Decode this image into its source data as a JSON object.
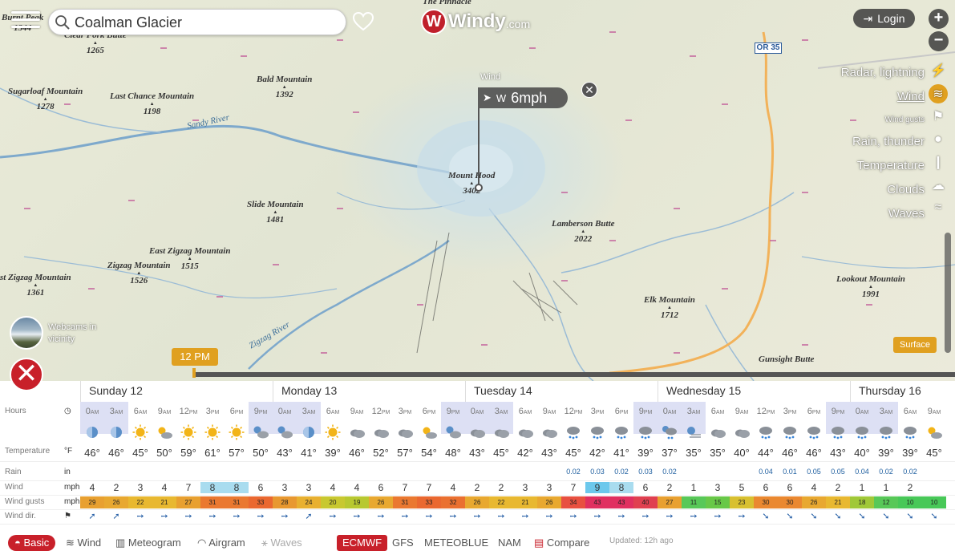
{
  "search": {
    "value": "Coalman Glacier"
  },
  "logo": {
    "mark": "W",
    "text": "Windy",
    "suffix": ".com"
  },
  "login_label": "Login",
  "zoom": {
    "in": "+",
    "out": "−"
  },
  "layers": [
    "Radar, lightning",
    "Wind",
    "Wind gusts",
    "Rain, thunder",
    "Temperature",
    "Clouds",
    "Waves"
  ],
  "active_layer": "Wind",
  "peaks": [
    {
      "name": "The Pinnacle",
      "elev": ""
    },
    {
      "name": "Burnt Peak",
      "elev": "1344"
    },
    {
      "name": "Clear Fork Butte",
      "elev": "1265"
    },
    {
      "name": "Sugarloaf Mountain",
      "elev": "1278"
    },
    {
      "name": "Bald Mountain",
      "elev": "1392"
    },
    {
      "name": "Last Chance Mountain",
      "elev": "1198"
    },
    {
      "name": "Mount Hood",
      "elev": "3402"
    },
    {
      "name": "Lamberson Butte",
      "elev": "2022"
    },
    {
      "name": "Slide Mountain",
      "elev": "1481"
    },
    {
      "name": "East Zigzag Mountain",
      "elev": "1515"
    },
    {
      "name": "Zigzag Mountain",
      "elev": "1526"
    },
    {
      "name": "st Zigzag Mountain",
      "elev": "1361"
    },
    {
      "name": "Elk Mountain",
      "elev": "1712"
    },
    {
      "name": "Lookout Mountain",
      "elev": "1991"
    },
    {
      "name": "Gunsight Butte",
      "elev": ""
    }
  ],
  "rivers": [
    "Sandy River",
    "Zigzag River"
  ],
  "road_badge": "OR 35",
  "wind_popup": {
    "label": "Wind",
    "dir": "W",
    "value": "6mph"
  },
  "webcam_label": [
    "Webcams in",
    "vicinity"
  ],
  "time_badge": "12 PM",
  "surface_label": "Surface",
  "forecast": {
    "days": [
      "Sunday 12",
      "Monday 13",
      "Tuesday 14",
      "Wednesday 15",
      "Thursday 16"
    ],
    "row_labels": {
      "hours": "Hours",
      "temperature": "Temperature",
      "temp_unit": "°F",
      "rain": "Rain",
      "rain_unit": "in",
      "wind": "Wind",
      "wind_unit": "mph",
      "gusts": "Wind gusts",
      "gusts_unit": "mph",
      "wdir": "Wind dir."
    },
    "hours": [
      "0",
      "3",
      "6",
      "9",
      "12",
      "3",
      "6",
      "9",
      "0",
      "3",
      "6",
      "9",
      "12",
      "3",
      "6",
      "9",
      "0",
      "3",
      "6",
      "9",
      "12",
      "3",
      "6",
      "9",
      "0",
      "3",
      "6",
      "9",
      "12",
      "3",
      "6",
      "9",
      "0",
      "3",
      "6",
      "9"
    ],
    "ampm": [
      "AM",
      "AM",
      "AM",
      "AM",
      "PM",
      "PM",
      "PM",
      "PM",
      "AM",
      "AM",
      "AM",
      "AM",
      "PM",
      "PM",
      "PM",
      "PM",
      "AM",
      "AM",
      "AM",
      "AM",
      "PM",
      "PM",
      "PM",
      "PM",
      "AM",
      "AM",
      "AM",
      "AM",
      "PM",
      "PM",
      "PM",
      "PM",
      "AM",
      "AM",
      "AM",
      "AM"
    ],
    "weather": [
      "moon",
      "moon",
      "sun",
      "suncloud",
      "sun",
      "sun",
      "sun",
      "cloudnight",
      "cloudnight",
      "moon",
      "sun",
      "cloud",
      "cloud",
      "cloud",
      "suncloud",
      "cloudnight",
      "cloud",
      "cloud",
      "cloud",
      "cloud",
      "rain",
      "rain",
      "rain",
      "rain",
      "rainnight",
      "moonfog",
      "cloud",
      "cloud",
      "rain",
      "rain",
      "rain",
      "rain",
      "rain",
      "rain",
      "rain",
      "suncloud"
    ],
    "temps": [
      "46°",
      "46°",
      "45°",
      "50°",
      "59°",
      "61°",
      "57°",
      "50°",
      "43°",
      "41°",
      "39°",
      "46°",
      "52°",
      "57°",
      "54°",
      "48°",
      "43°",
      "45°",
      "42°",
      "43°",
      "45°",
      "42°",
      "41°",
      "39°",
      "37°",
      "35°",
      "35°",
      "40°",
      "44°",
      "46°",
      "46°",
      "43°",
      "40°",
      "39°",
      "39°",
      "45°"
    ],
    "rain": [
      "",
      "",
      "",
      "",
      "",
      "",
      "",
      "",
      "",
      "",
      "",
      "",
      "",
      "",
      "",
      "",
      "",
      "",
      "",
      "",
      "0.02",
      "0.03",
      "0.02",
      "0.03",
      "0.02",
      "",
      "",
      "",
      "0.04",
      "0.01",
      "0.05",
      "0.05",
      "0.04",
      "0.02",
      "0.02",
      ""
    ],
    "wind": [
      "4",
      "2",
      "3",
      "4",
      "7",
      "8",
      "8",
      "6",
      "3",
      "3",
      "4",
      "4",
      "6",
      "7",
      "7",
      "4",
      "2",
      "2",
      "3",
      "3",
      "7",
      "9",
      "8",
      "6",
      "2",
      "1",
      "3",
      "5",
      "6",
      "6",
      "4",
      "2",
      "1",
      "1",
      "2",
      ""
    ],
    "gusts": [
      "29",
      "26",
      "22",
      "21",
      "27",
      "31",
      "31",
      "33",
      "28",
      "24",
      "20",
      "19",
      "26",
      "31",
      "33",
      "32",
      "26",
      "22",
      "21",
      "26",
      "34",
      "43",
      "43",
      "40",
      "27",
      "11",
      "15",
      "23",
      "30",
      "30",
      "26",
      "21",
      "18",
      "12",
      "10",
      "10"
    ],
    "gust_colors": [
      "#e8a030",
      "#e8a830",
      "#e8b830",
      "#e8b830",
      "#e8a030",
      "#ea7830",
      "#ea7830",
      "#ea6830",
      "#e89830",
      "#e8b030",
      "#c8c830",
      "#b8c830",
      "#e8a830",
      "#ea7830",
      "#ea6830",
      "#ea7030",
      "#e8a830",
      "#e8b830",
      "#e8b830",
      "#e8a830",
      "#e85040",
      "#e03060",
      "#e03060",
      "#e04050",
      "#e8a030",
      "#58c858",
      "#68c848",
      "#d8c030",
      "#ea8830",
      "#ea8830",
      "#e8a830",
      "#e8b830",
      "#a0c838",
      "#58c858",
      "#48c858",
      "#48c858"
    ],
    "wdir": [
      "➚",
      "➚",
      "➙",
      "➙",
      "➙",
      "➙",
      "➙",
      "➙",
      "➙",
      "➚",
      "➙",
      "➙",
      "➙",
      "➙",
      "➙",
      "➙",
      "➙",
      "➙",
      "➙",
      "➙",
      "➙",
      "➙",
      "➙",
      "➙",
      "➙",
      "➙",
      "➙",
      "➙",
      "➘",
      "➘",
      "➘",
      "➘",
      "➘",
      "➘",
      "➘",
      "➘"
    ]
  },
  "tabs": [
    "Basic",
    "Wind",
    "Meteogram",
    "Airgram",
    "Waves"
  ],
  "models": [
    "ECMWF",
    "GFS",
    "METEOBLUE",
    "NAM",
    "Compare"
  ],
  "updated": "Updated: 12h ago"
}
